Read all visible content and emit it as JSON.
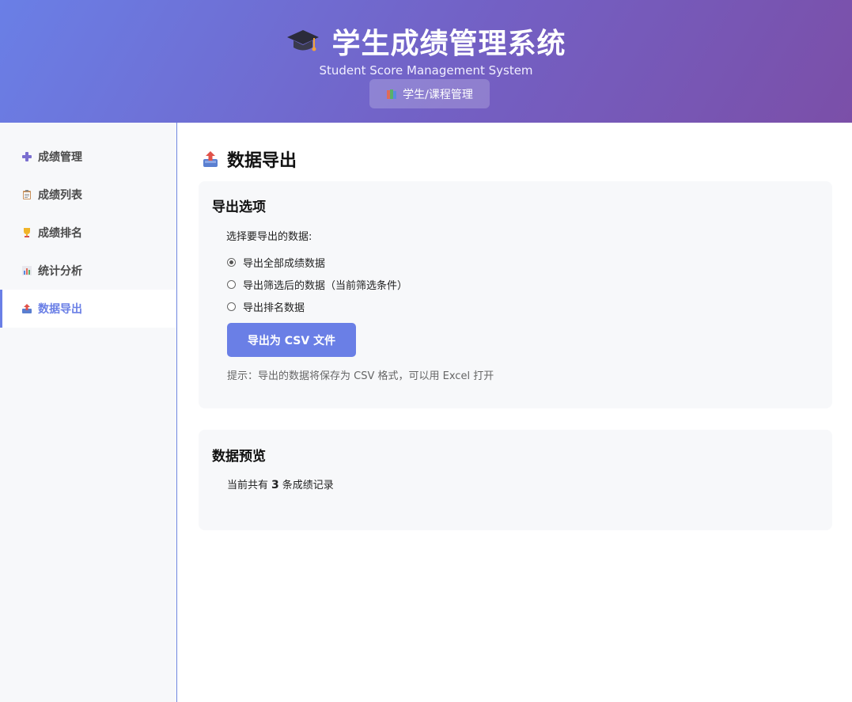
{
  "header": {
    "title": "学生成绩管理系统",
    "subtitle": "Student Score Management System",
    "nav_button": "学生/课程管理"
  },
  "sidebar": {
    "items": [
      {
        "label": "成绩管理",
        "icon": "plus-icon"
      },
      {
        "label": "成绩列表",
        "icon": "clipboard-icon"
      },
      {
        "label": "成绩排名",
        "icon": "trophy-icon"
      },
      {
        "label": "统计分析",
        "icon": "bar-chart-icon"
      },
      {
        "label": "数据导出",
        "icon": "outbox-tray-icon",
        "active": true
      }
    ]
  },
  "main": {
    "page_title": "数据导出",
    "export_card": {
      "title": "导出选项",
      "choose_label": "选择要导出的数据:",
      "options": [
        {
          "label": "导出全部成绩数据",
          "checked": true
        },
        {
          "label": "导出筛选后的数据（当前筛选条件）",
          "checked": false
        },
        {
          "label": "导出排名数据",
          "checked": false
        }
      ],
      "button_label": "导出为 CSV 文件",
      "hint": "提示：导出的数据将保存为 CSV 格式，可以用 Excel 打开"
    },
    "preview_card": {
      "title": "数据预览",
      "record_prefix": "当前共有",
      "record_count": "3",
      "record_suffix": "条成绩记录"
    }
  },
  "colors": {
    "accent": "#6a7fe6",
    "header_gradient_start": "#6a7fe6",
    "header_gradient_end": "#7b4fa8",
    "card_bg": "#f7f8fa"
  }
}
